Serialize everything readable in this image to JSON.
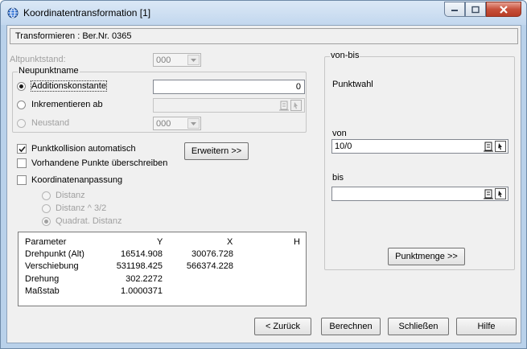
{
  "window": {
    "title": "Koordinatentransformation [1]"
  },
  "header": {
    "text": "Transformieren : Ber.Nr. 0365"
  },
  "left": {
    "altpunktstand_label": "Altpunktstand:",
    "altpunktstand_value": "000",
    "neupunktname_group": "Neupunktname",
    "option_additionskonstante": "Additionskonstante",
    "additionskonstante_value": "0",
    "option_inkrementieren": "Inkrementieren ab",
    "inkrementieren_value": "",
    "option_neustand": "Neustand",
    "neustand_value": "000",
    "punktkollision_label": "Punktkollision automatisch",
    "vorhandene_label": "Vorhandene Punkte überschreiben",
    "koordinatenanpassung_label": "Koordinatenanpassung",
    "erweitern_button": "Erweitern >>",
    "opt_distanz": "Distanz",
    "opt_distanz32": "Distanz ^ 3/2",
    "opt_quadrat": "Quadrat. Distanz"
  },
  "params": {
    "headers": [
      "Parameter",
      "Y",
      "X",
      "H"
    ],
    "rows": [
      [
        "Drehpunkt (Alt)",
        "16514.908",
        "30076.728",
        ""
      ],
      [
        "Verschiebung",
        "531198.425",
        "566374.228",
        ""
      ],
      [
        "Drehung",
        "302.2272",
        "",
        ""
      ],
      [
        "Maßstab",
        "1.0000371",
        "",
        ""
      ]
    ]
  },
  "right": {
    "group_title": "von-bis",
    "punktwahl_label": "Punktwahl",
    "von_label": "von",
    "von_value": "10/0",
    "bis_label": "bis",
    "bis_value": "",
    "punktmenge_button": "Punktmenge >>"
  },
  "footer": {
    "zurueck_button": "< Zurück",
    "berechnen_button": "Berechnen",
    "schliessen_button": "Schließen",
    "hilfe_button": "Hilfe"
  }
}
